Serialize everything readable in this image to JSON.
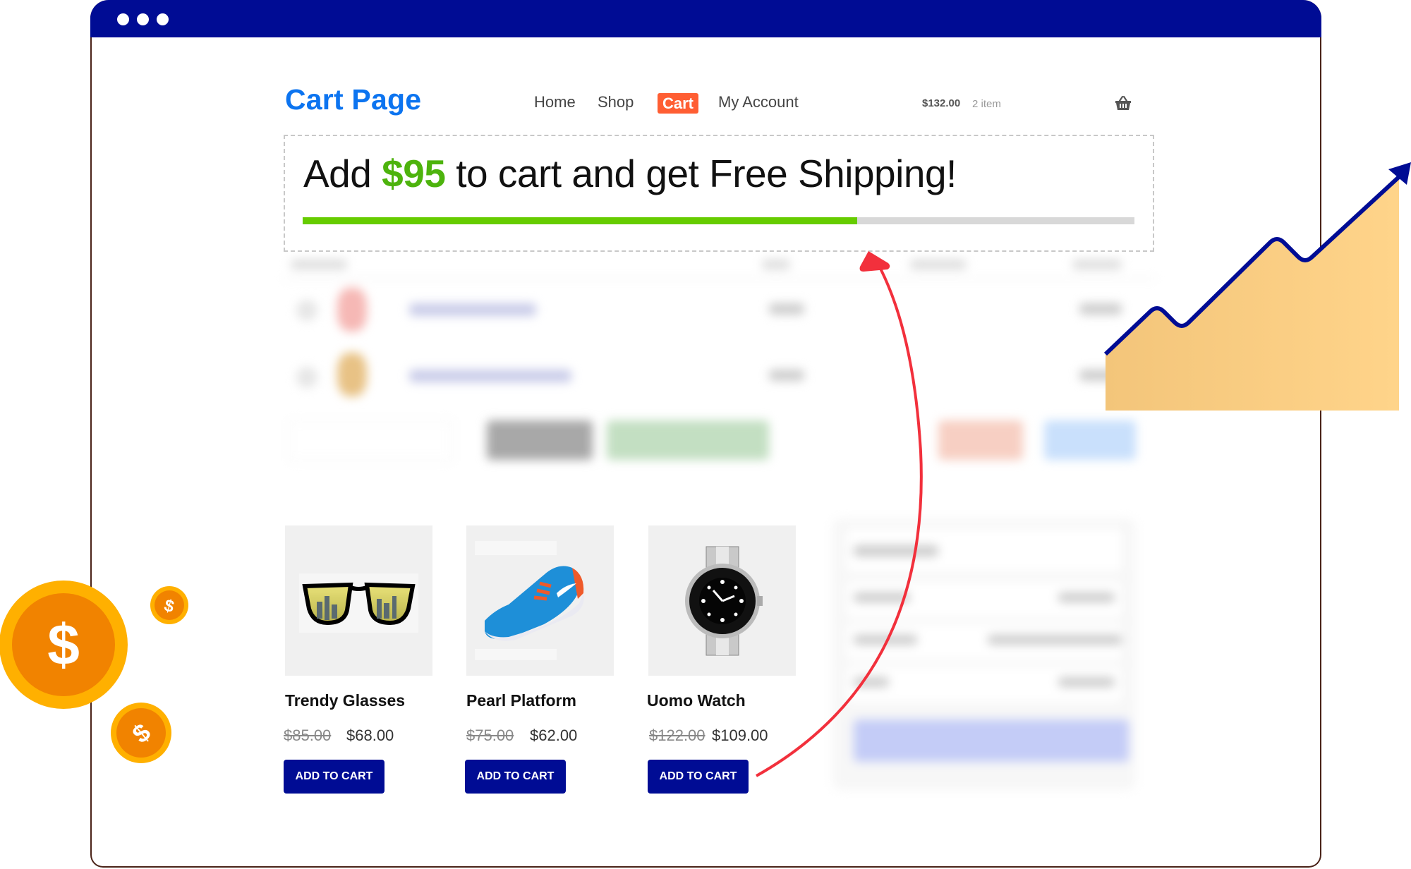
{
  "window": {
    "controls": [
      "dot",
      "dot",
      "dot"
    ]
  },
  "header": {
    "site_title": "Cart Page",
    "nav": [
      {
        "label": "Home",
        "active": false
      },
      {
        "label": "Shop",
        "active": false
      },
      {
        "label": "Cart",
        "active": true
      },
      {
        "label": "My Account",
        "active": false
      }
    ],
    "mini_cart": {
      "total": "$132.00",
      "count": "2 item",
      "icon": "basket-icon"
    }
  },
  "free_shipping": {
    "prefix": "Add",
    "amount": "$95",
    "suffix": "to cart and get Free Shipping!",
    "progress_fraction": 0.667,
    "colors": {
      "fill": "#66cc00",
      "track": "#d8d8d8",
      "amount": "#4db30d"
    }
  },
  "products": [
    {
      "name": "Trendy Glasses",
      "old_price": "$85.00",
      "price": "$68.00",
      "button": "ADD TO CART",
      "image": "sunglasses"
    },
    {
      "name": "Pearl Platform",
      "old_price": "$75.00",
      "price": "$62.00",
      "button": "ADD TO CART",
      "image": "sneaker"
    },
    {
      "name": "Uomo Watch",
      "old_price": "$122.00",
      "price": "$109.00",
      "button": "ADD TO CART",
      "image": "wristwatch"
    }
  ],
  "colors": {
    "brand": "#000c94",
    "title": "#0c74f0",
    "nav_active": "#ff5e33",
    "arrow": "#f2303c",
    "growth_fill": "#f5c77a",
    "coin_outer": "#ffb000",
    "coin_inner": "#f18300"
  },
  "decorations": {
    "growth_chart_icon": "trending-up-icon",
    "coins_icon": "dollar-coin-icon"
  }
}
